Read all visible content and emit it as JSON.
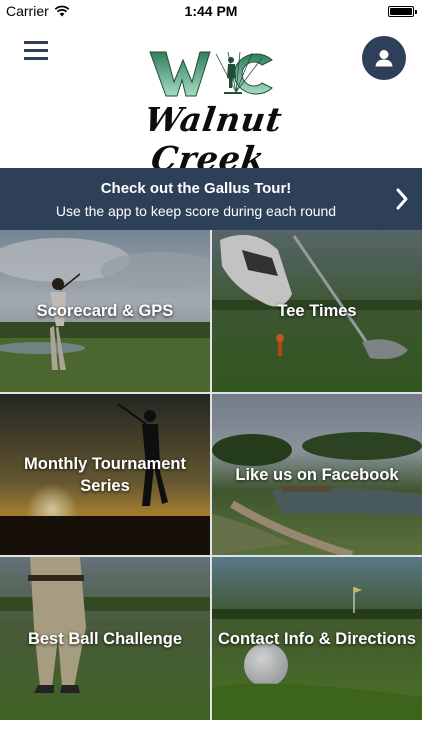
{
  "status_bar": {
    "carrier": "Carrier",
    "time": "1:44 PM"
  },
  "header": {
    "logo_text": "Walnut Creek",
    "menu_icon": "list-icon",
    "profile_icon": "person-icon"
  },
  "banner": {
    "title": "Check out the Gallus Tour!",
    "subtitle": "Use the app to keep score during each round",
    "icon": "chevron-right-icon"
  },
  "tiles": [
    {
      "label": "Scorecard & GPS"
    },
    {
      "label": "Tee Times"
    },
    {
      "label": "Monthly Tournament Series"
    },
    {
      "label": "Like us on Facebook"
    },
    {
      "label": "Best Ball Challenge"
    },
    {
      "label": "Contact Info & Directions"
    }
  ],
  "colors": {
    "brand_navy": "#2d4057",
    "logo_green": "#5fb08a"
  }
}
